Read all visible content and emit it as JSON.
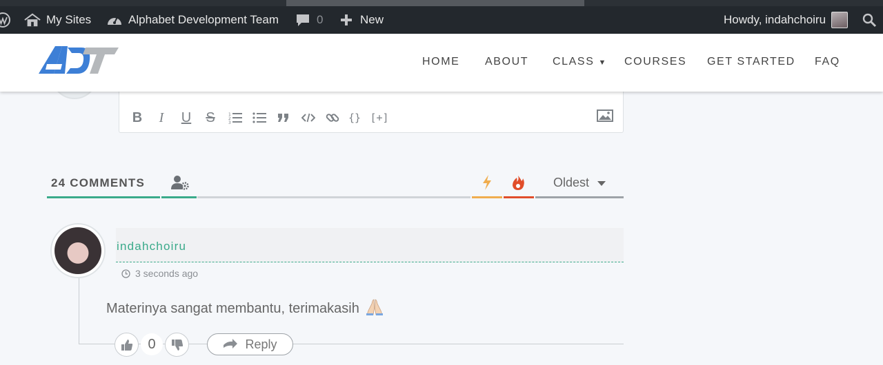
{
  "adminbar": {
    "wp_logo_icon": "wordpress-icon",
    "my_sites_label": "My Sites",
    "site_name": "Alphabet Development Team",
    "comments_count": "0",
    "new_label": "New",
    "howdy": "Howdy, indahchoiru"
  },
  "header": {
    "logo_text": "ADT",
    "nav": [
      "HOME",
      "ABOUT",
      "CLASS",
      "COURSES",
      "GET STARTED",
      "FAQ"
    ]
  },
  "editor": {
    "tools": [
      "bold",
      "italic",
      "underline",
      "strikethrough",
      "ordered-list",
      "unordered-list",
      "quote",
      "code",
      "link",
      "code-block",
      "spoiler"
    ],
    "code_block_label": "{}",
    "spoiler_label": "[+]"
  },
  "comments": {
    "count_label": "24 COMMENTS",
    "sort_label": "Oldest",
    "colors": {
      "accent": "#3aaa8a",
      "bolt": "#f0ad4e",
      "fire": "#e14d2a"
    }
  },
  "comment": {
    "author": "indahchoiru",
    "time": "3 seconds ago",
    "text": "Materinya sangat membantu, terimakasih",
    "votes": "0",
    "reply_label": "Reply"
  }
}
